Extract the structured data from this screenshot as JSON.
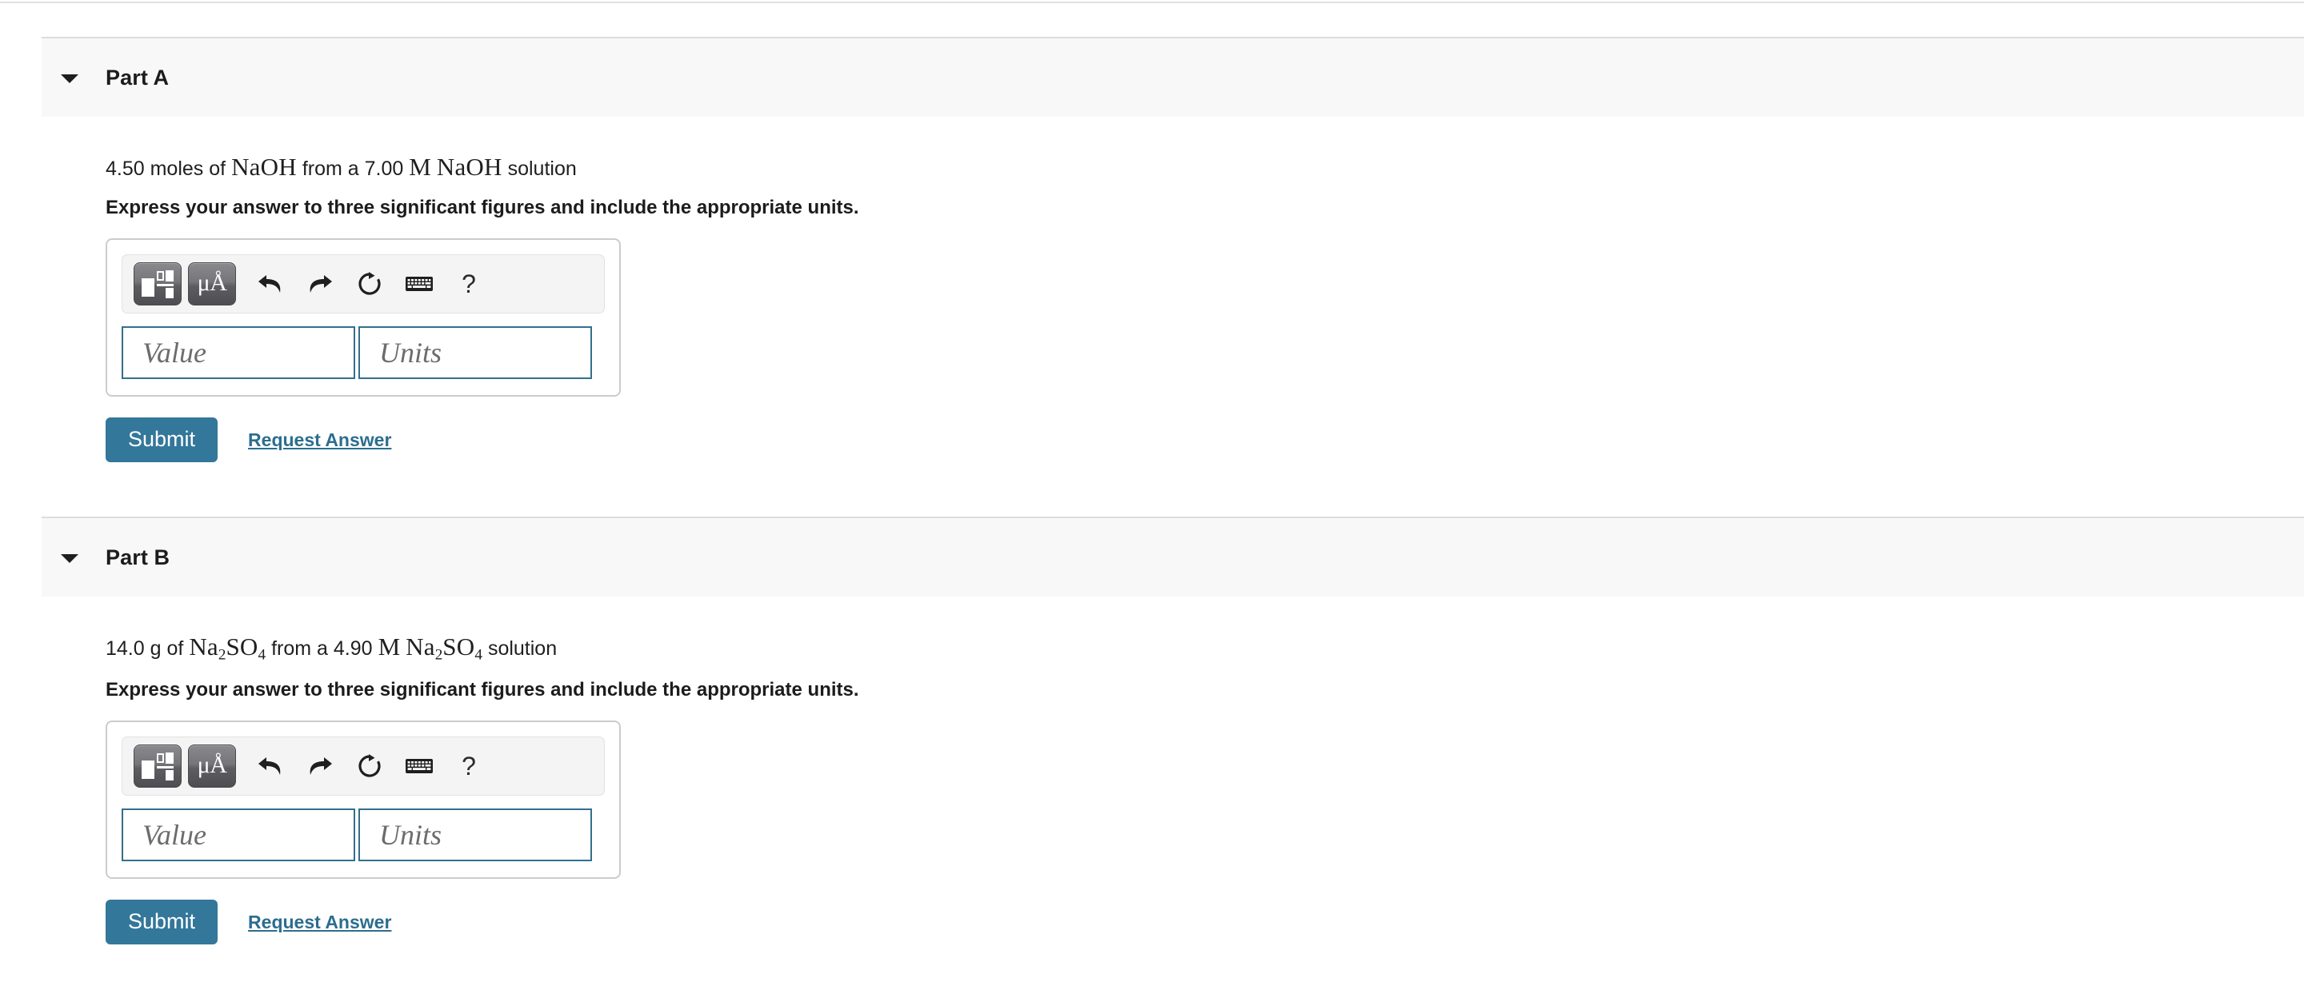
{
  "colors": {
    "accent": "#33779a",
    "link": "#2c6d8f",
    "field_border": "#336f8c",
    "header_bg": "#f8f8f8",
    "divider": "#dddddd"
  },
  "parts": [
    {
      "id": "part-a",
      "title": "Part A",
      "question": {
        "quantity": "4.50 moles of",
        "substance": "NaOH",
        "middle": "from a 7.00",
        "molarity_symbol": "M",
        "solution_substance": "NaOH",
        "suffix": "solution"
      },
      "instruction": "Express your answer to three significant figures and include the appropriate units.",
      "answer": {
        "value_placeholder": "Value",
        "units_placeholder": "Units",
        "value": "",
        "units": ""
      },
      "toolbar": {
        "template_label": "math-template",
        "units_label": "μÅ",
        "undo_label": "Undo",
        "redo_label": "Redo",
        "reset_label": "Reset",
        "keyboard_label": "Keyboard shortcuts",
        "help_label": "?"
      },
      "submit_label": "Submit",
      "request_label": "Request Answer"
    },
    {
      "id": "part-b",
      "title": "Part B",
      "question": {
        "quantity": "14.0 g of",
        "substance": "Na₂SO₄",
        "middle": "from a 4.90",
        "molarity_symbol": "M",
        "solution_substance": "Na₂SO₄",
        "suffix": "solution"
      },
      "instruction": "Express your answer to three significant figures and include the appropriate units.",
      "answer": {
        "value_placeholder": "Value",
        "units_placeholder": "Units",
        "value": "",
        "units": ""
      },
      "toolbar": {
        "template_label": "math-template",
        "units_label": "μÅ",
        "undo_label": "Undo",
        "redo_label": "Redo",
        "reset_label": "Reset",
        "keyboard_label": "Keyboard shortcuts",
        "help_label": "?"
      },
      "submit_label": "Submit",
      "request_label": "Request Answer"
    }
  ]
}
